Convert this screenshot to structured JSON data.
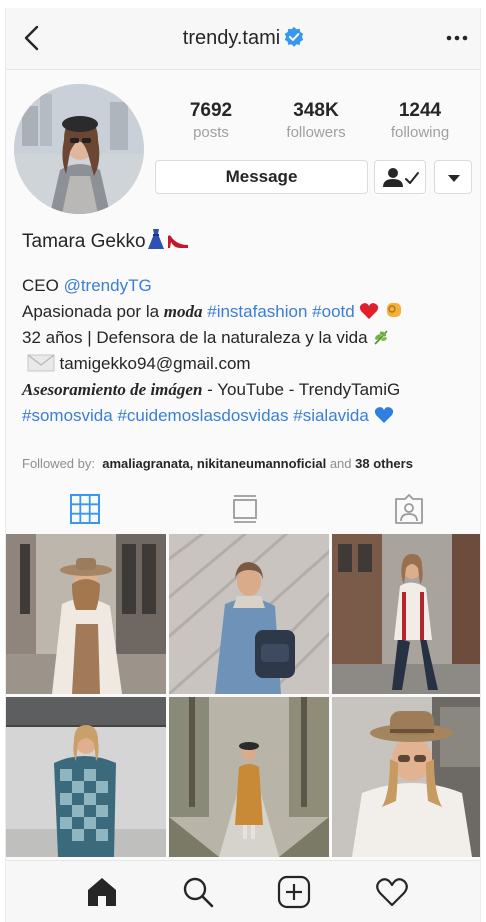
{
  "header": {
    "username": "trendy.tami",
    "back_icon": "chevron-left-icon",
    "verified_icon": "verified-badge-icon",
    "more_icon": "more-horizontal-icon"
  },
  "stats": {
    "posts": {
      "value": "7692",
      "label": "posts"
    },
    "followers": {
      "value": "348K",
      "label": "followers"
    },
    "following": {
      "value": "1244",
      "label": "following"
    }
  },
  "actions": {
    "message_label": "Message",
    "following_icon": "person-check-icon",
    "dropdown_icon": "caret-down-icon"
  },
  "bio": {
    "name": "Tamara Gekko",
    "line1_text": "CEO ",
    "line1_link": "@trendyTG",
    "line2_text": "Apasionada por la ",
    "line2_italic": "moda",
    "line2_tag1": "#instafashion",
    "line2_tag2": "#ootd",
    "line3_text": "32 años | Defensora de la naturaleza y la vida",
    "line4_email": "tamigekko94@gmail.com",
    "line5_italic": "Asesoramiento de imágen",
    "line5_text": " - YouTube - TrendyTamiG",
    "line6_tag1": "#somosvida",
    "line6_tag2": "#cuidemoslasdosvidas",
    "line6_tag3": "#sialavida"
  },
  "followed_by": {
    "prefix": "Followed by:",
    "names": "amaliagranata, nikitaneumannoficial",
    "and": "and",
    "others": "38 others"
  },
  "tabs": [
    {
      "name": "grid",
      "icon": "grid-icon",
      "active": true
    },
    {
      "name": "feed",
      "icon": "feed-icon",
      "active": false
    },
    {
      "name": "tagged",
      "icon": "tagged-person-icon",
      "active": false
    }
  ],
  "posts": [
    {
      "id": "post-1"
    },
    {
      "id": "post-2"
    },
    {
      "id": "post-3"
    },
    {
      "id": "post-4"
    },
    {
      "id": "post-5"
    },
    {
      "id": "post-6"
    }
  ],
  "nav": [
    {
      "name": "home",
      "icon": "home-icon"
    },
    {
      "name": "search",
      "icon": "search-icon"
    },
    {
      "name": "new-post",
      "icon": "plus-square-icon"
    },
    {
      "name": "activity",
      "icon": "heart-icon"
    }
  ],
  "colors": {
    "link": "#3b7ed6",
    "verified": "#3897f0",
    "active_tab": "#3897f0",
    "muted": "#a0a0a0"
  }
}
